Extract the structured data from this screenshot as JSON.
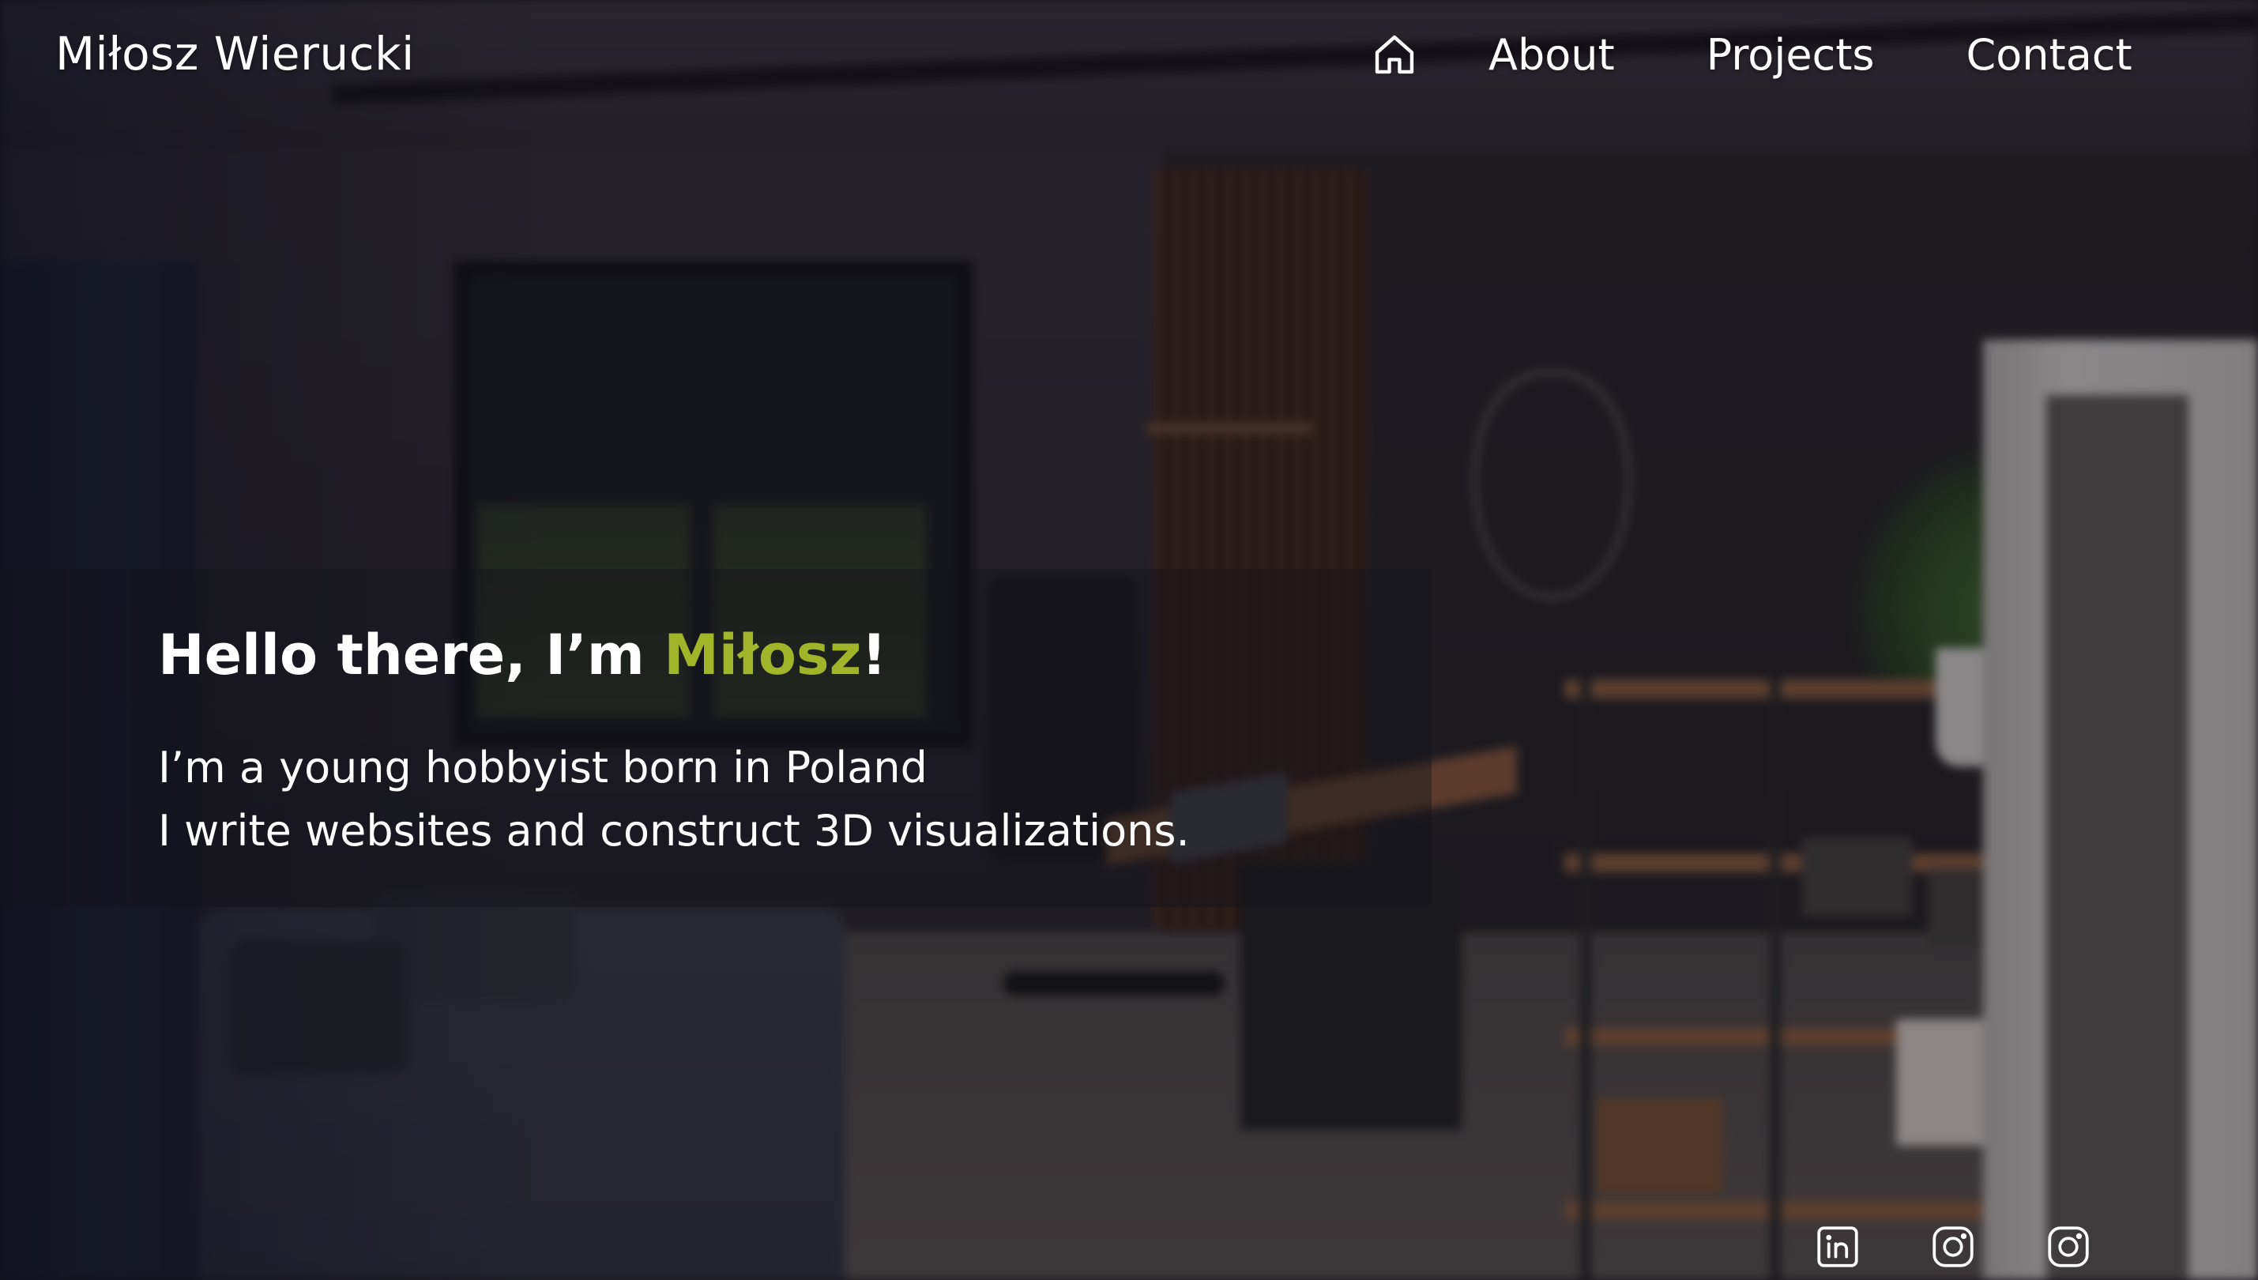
{
  "brand": {
    "name": "Miłosz Wierucki"
  },
  "nav": {
    "home_icon": "home-icon",
    "items": [
      {
        "label": "About"
      },
      {
        "label": "Projects"
      },
      {
        "label": "Contact"
      }
    ]
  },
  "hero": {
    "greeting_prefix": "Hello there, I’m ",
    "greeting_name": "Miłosz",
    "greeting_suffix": "!",
    "line1": "I’m a young hobbyist born in Poland",
    "line2": "I write websites and construct 3D visualizations.",
    "accent_color": "#a0b52a"
  },
  "socials": [
    {
      "icon": "linkedin-icon"
    },
    {
      "icon": "instagram-icon"
    },
    {
      "icon": "instagram-icon"
    }
  ]
}
